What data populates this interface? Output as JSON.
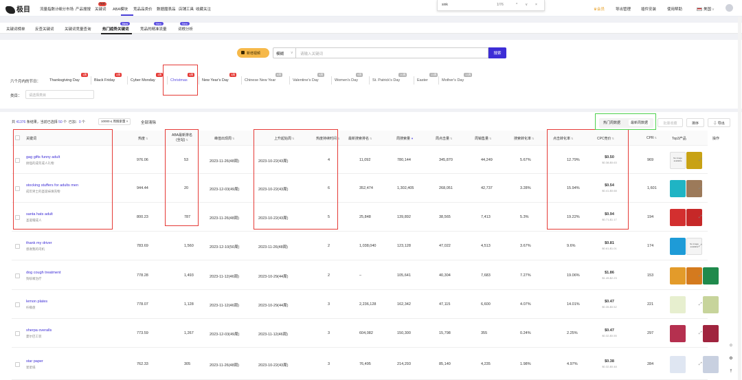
{
  "brand": {
    "name": "极目"
  },
  "nav": [
    {
      "label": "流量指数计"
    },
    {
      "label": "细分市场"
    },
    {
      "label": "产品搜搜"
    },
    {
      "label": "关键词",
      "badge": "hot"
    },
    {
      "label": "ABA模块"
    },
    {
      "label": "竞品品类价"
    },
    {
      "label": "数据魔表品"
    },
    {
      "label": "店铺工具"
    },
    {
      "label": "收藏关注"
    }
  ],
  "find_bar": {
    "query": "sink",
    "count": "1/76",
    "up": "^",
    "down": "v",
    "close": "×"
  },
  "top_right": {
    "vip": "会员",
    "export_mgmt": "导出管理",
    "plugin": "插件安装",
    "help": "使用帮助",
    "region": "美国",
    "region_caret": "v"
  },
  "subtabs": [
    {
      "label": "关键词榜单"
    },
    {
      "label": "反查关键词"
    },
    {
      "label": "关键词竞量查询"
    },
    {
      "label": "热门趋势关键词",
      "badge": "New",
      "active": true
    },
    {
      "label": "竞品的精准流量",
      "badge": "New"
    },
    {
      "label": "词根分析",
      "badge": "New"
    }
  ],
  "search": {
    "tutorial": "新增视频",
    "mode": "模糊",
    "mode_caret": "v",
    "placeholder": "请输入关键词",
    "button": "搜索"
  },
  "festivals": {
    "label": "六个月内的节日：",
    "items": [
      {
        "name": "Thanksgiving Day",
        "badge": "1周",
        "color": "#e53935"
      },
      {
        "name": "Black Friday",
        "badge": "2周",
        "color": "#e53935"
      },
      {
        "name": "Cyber Monday",
        "badge": "1周",
        "color": "#e53935"
      },
      {
        "name": "Christmas",
        "badge": "3周",
        "color": "#e53935"
      },
      {
        "name": "New Year's Day",
        "badge": "3周",
        "color": "#e53935"
      },
      {
        "name": "Chinese New Year",
        "badge": "8周",
        "color": "#b5b5b5"
      },
      {
        "name": "Valentine's Day",
        "badge": "9周",
        "color": "#b5b5b5"
      },
      {
        "name": "Women's Day",
        "badge": "9周",
        "color": "#b5b5b5"
      },
      {
        "name": "St. Patrick's Day",
        "badge": "10周",
        "color": "#b5b5b5"
      },
      {
        "name": "Easter",
        "badge": "13周",
        "color": "#b5b5b5"
      },
      {
        "name": "Mother's Day",
        "badge": "13周",
        "color": "#b5b5b5"
      }
    ]
  },
  "category": {
    "label": "类目：",
    "placeholder": "请选择类目"
  },
  "table_toolbar": {
    "info_prefix": "共",
    "total": "41376",
    "info_mid": "条结果，当前已选择",
    "selected": "50",
    "info_mid2": "个",
    "added_label": "已加：",
    "added": "0",
    "added_unit": "个",
    "chip": "10000 ≤ 周搜索量",
    "chip_close": "×",
    "clear": "全部清除",
    "seg_hot": "热门周数据",
    "seg_latest": "最新周数据",
    "batch_collect": "批量收藏",
    "sort": "排序",
    "export": "导出"
  },
  "columns": {
    "keyword": "关键词",
    "heat": "热度",
    "aba_rank": "ABA最新排名",
    "aba_rank2": "(全站)",
    "peak": "峰值出现周",
    "rise_start": "上升起始周",
    "rise_weeks": "热度持续时间",
    "latest_rank": "最新搜索排名",
    "weekly_search": "周搜索量",
    "weekly_click": "周点击量",
    "weekly_sales": "周销售量",
    "search_conv": "搜索转化率",
    "click_conv": "点击转化率",
    "cpc": "CPC竞价",
    "cpr": "CPR",
    "top3": "Top3产品",
    "action": "操作"
  },
  "rows": [
    {
      "kw": "gag gifts funny adult",
      "cn": "搞怪的成年成人礼物",
      "heat": "976.06",
      "aba": "53",
      "peak": "2023-11-26(48周)",
      "rise": "2023-10-22(43周)",
      "dur": "4",
      "rank": "11,092",
      "search": "780,144",
      "click": "345,870",
      "sales": "44,249",
      "sconv": "5.67%",
      "cconv": "12.79%",
      "cpc": "$0.50",
      "cpcr": "$0.38-$0.63",
      "cpr": "969",
      "thumbs": [
        "#f2f2f2",
        "#c8a214",
        "#fff"
      ]
    },
    {
      "kw": "stocking stuffers for adults men",
      "cn": "成年男士的圣诞袜填充物",
      "heat": "944.44",
      "aba": "20",
      "peak": "2023-12-03(49周)",
      "rise": "2023-10-22(43周)",
      "dur": "6",
      "rank": "352,474",
      "search": "1,302,405",
      "click": "268,051",
      "sales": "42,737",
      "sconv": "3.28%",
      "cconv": "15.94%",
      "cpc": "$0.54",
      "cpcr": "$0.41-$0.68",
      "cpr": "1,601",
      "thumbs": [
        "#1fb4c4",
        "#9c7a5a",
        "#fff"
      ]
    },
    {
      "kw": "santa hats adult",
      "cn": "圣诞帽成人",
      "heat": "800.23",
      "aba": "787",
      "peak": "2023-11-26(48周)",
      "rise": "2023-10-22(43周)",
      "dur": "5",
      "rank": "25,848",
      "search": "139,892",
      "click": "38,565",
      "sales": "7,413",
      "sconv": "5.3%",
      "cconv": "19.22%",
      "cpc": "$0.94",
      "cpcr": "$0.71-$1.17",
      "cpr": "194",
      "thumbs": [
        "#d32f2f",
        "#c62828",
        "#fff"
      ]
    },
    {
      "kw": "thank my driver",
      "cn": "感谢我的司机",
      "heat": "783.69",
      "aba": "1,560",
      "peak": "2023-12-10(50周)",
      "rise": "2023-11-26(48周)",
      "dur": "2",
      "rank": "1,038,040",
      "search": "123,128",
      "click": "47,022",
      "sales": "4,513",
      "sconv": "3.67%",
      "cconv": "9.6%",
      "cpc": "$0.81",
      "cpcr": "$0.61-$1.01",
      "cpr": "174",
      "thumbs": [
        "#1e9bd7",
        "#f2f2f2",
        "#fff"
      ]
    },
    {
      "kw": "dog cough treatment",
      "cn": "狗咳嗽治疗",
      "heat": "778.28",
      "aba": "1,493",
      "peak": "2023-11-12(46周)",
      "rise": "2023-10-29(44周)",
      "dur": "2",
      "rank": "–",
      "search": "105,641",
      "click": "40,304",
      "sales": "7,683",
      "sconv": "7.27%",
      "cconv": "19.06%",
      "cpc": "$1.86",
      "cpcr": "$1.49-$2.23",
      "cpr": "153",
      "thumbs": [
        "#e39b2a",
        "#d47a1e",
        "#1f8a4c"
      ]
    },
    {
      "kw": "lemon plates",
      "cn": "柠檬盘",
      "heat": "778.07",
      "aba": "1,128",
      "peak": "2023-11-12(46周)",
      "rise": "2023-10-29(44周)",
      "dur": "3",
      "rank": "2,236,128",
      "search": "162,342",
      "click": "47,115",
      "sales": "6,600",
      "sconv": "4.07%",
      "cconv": "14.01%",
      "cpc": "$0.47",
      "cpcr": "$0.35-$0.52",
      "cpr": "221",
      "thumbs": [
        "#e7efcf",
        "#fff",
        "#c7d49b"
      ]
    },
    {
      "kw": "sherpa overalls",
      "cn": "夏尔巴工装",
      "heat": "773.59",
      "aba": "1,267",
      "peak": "2023-12-03(49周)",
      "rise": "2023-11-12(46周)",
      "dur": "3",
      "rank": "604,082",
      "search": "150,300",
      "click": "15,798",
      "sales": "355",
      "sconv": "0.24%",
      "cconv": "2.25%",
      "cpc": "$0.47",
      "cpcr": "$0.32-$0.55",
      "cpr": "297",
      "thumbs": [
        "#b5304f",
        "#fff",
        "#a0243e"
      ]
    },
    {
      "kw": "star paper",
      "cn": "星星纸",
      "heat": "762.33",
      "aba": "305",
      "peak": "2023-11-26(48周)",
      "rise": "2023-10-22(43周)",
      "dur": "3",
      "rank": "76,495",
      "search": "214,293",
      "click": "85,140",
      "sales": "4,235",
      "sconv": "1.98%",
      "cconv": "4.97%",
      "cpc": "$0.38",
      "cpcr": "$0.32-$0.48",
      "cpr": "284",
      "thumbs": [
        "#dfe6f2",
        "#fff",
        "#c8d0e0"
      ]
    }
  ],
  "no_image_text": "No image available",
  "float_icons": {
    "support": "☺",
    "settings": "⚙",
    "top": "⤒"
  }
}
